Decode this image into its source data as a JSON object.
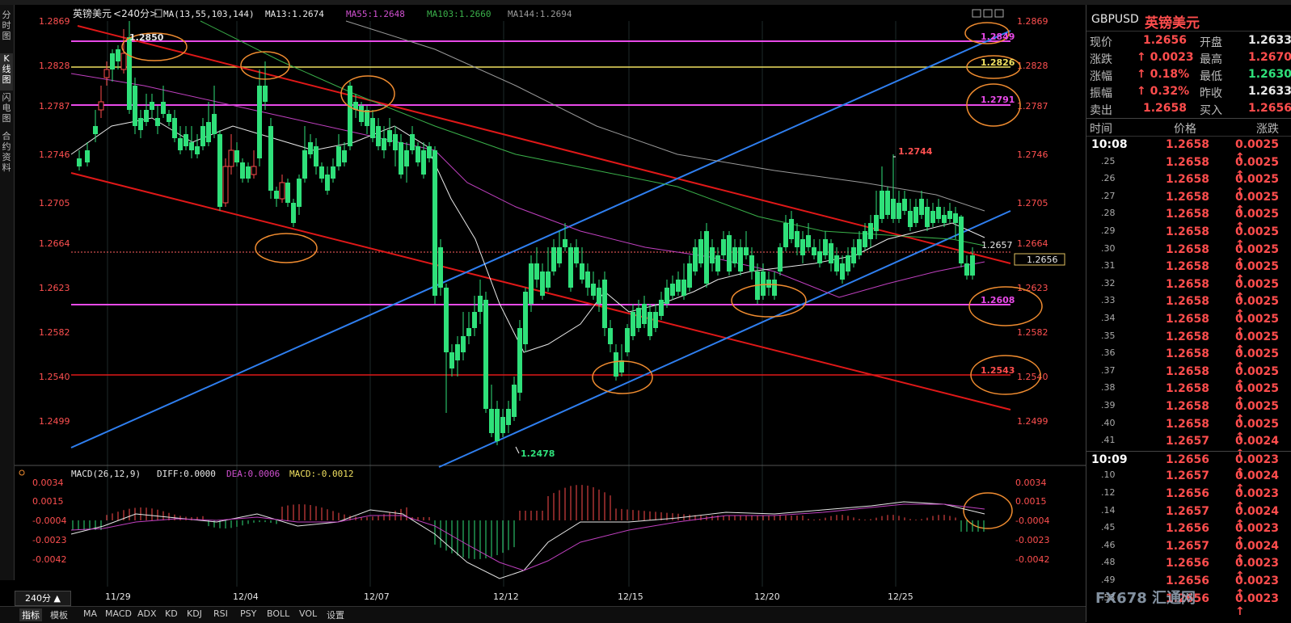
{
  "symbol_name": "英镑美元",
  "period": "240分",
  "ma_header": {
    "label": "MA(13,55,103,144)",
    "ma13": "MA13:1.2674",
    "ma55": "MA55:1.2648",
    "ma103": "MA103:1.2660",
    "ma144": "MA144:1.2694"
  },
  "left_tabs": [
    "分时图",
    "K线图",
    "闪电图",
    "合约资料"
  ],
  "price_axis": [
    "1.2869",
    "1.2828",
    "1.2787",
    "1.2746",
    "1.2705",
    "1.2664",
    "1.2623",
    "1.2582",
    "1.2540",
    "1.2499"
  ],
  "hlines": {
    "h1": "1.2849",
    "h2": "1.2826",
    "h3": "1.2791",
    "h4": "1.2608",
    "h5": "1.2543"
  },
  "annotations": {
    "high": "1.2850",
    "recent_high": "1.2744",
    "low": "1.2478",
    "last": "1.2657",
    "current_tag": "1.2656"
  },
  "macd_header": {
    "label": "MACD(26,12,9)",
    "diff": "DIFF:0.0000",
    "dea": "DEA:0.0006",
    "macd": "MACD:-0.0012"
  },
  "macd_axis": [
    "0.0034",
    "0.0015",
    "-0.0004",
    "-0.0023",
    "-0.0042"
  ],
  "dates": [
    "11/29",
    "12/04",
    "12/07",
    "12/12",
    "12/15",
    "12/20",
    "12/25"
  ],
  "bottom_tabs": [
    "指标",
    "模板",
    "MA",
    "MACD",
    "ADX",
    "KD",
    "KDJ",
    "RSI",
    "PSY",
    "BOLL",
    "VOL",
    "设置"
  ],
  "quote": {
    "code": "GBPUSD",
    "name": "英镑美元",
    "current_label": "现价",
    "current": "1.2656",
    "open_label": "开盘",
    "open": "1.2633",
    "change_label": "涨跌",
    "change": "0.0023",
    "high_label": "最高",
    "high": "1.2670",
    "pct_label": "涨幅",
    "pct": "0.18%",
    "low_label": "最低",
    "low": "1.2630",
    "amp_label": "振幅",
    "amp": "0.32%",
    "prev_label": "昨收",
    "prev": "1.2633",
    "sell_label": "卖出",
    "sell": "1.2658",
    "buy_label": "买入",
    "buy": "1.2656"
  },
  "ticks_header": {
    "time": "时间",
    "price": "价格",
    "change": "涨跌"
  },
  "ticks": [
    {
      "t": "10:08",
      "p": "1.2658",
      "c": "0.0025"
    },
    {
      "t": ".25",
      "p": "1.2658",
      "c": "0.0025"
    },
    {
      "t": ".26",
      "p": "1.2658",
      "c": "0.0025"
    },
    {
      "t": ".27",
      "p": "1.2658",
      "c": "0.0025"
    },
    {
      "t": ".28",
      "p": "1.2658",
      "c": "0.0025"
    },
    {
      "t": ".29",
      "p": "1.2658",
      "c": "0.0025"
    },
    {
      "t": ".30",
      "p": "1.2658",
      "c": "0.0025"
    },
    {
      "t": ".31",
      "p": "1.2658",
      "c": "0.0025"
    },
    {
      "t": ".32",
      "p": "1.2658",
      "c": "0.0025"
    },
    {
      "t": ".33",
      "p": "1.2658",
      "c": "0.0025"
    },
    {
      "t": ".34",
      "p": "1.2658",
      "c": "0.0025"
    },
    {
      "t": ".35",
      "p": "1.2658",
      "c": "0.0025"
    },
    {
      "t": ".36",
      "p": "1.2658",
      "c": "0.0025"
    },
    {
      "t": ".37",
      "p": "1.2658",
      "c": "0.0025"
    },
    {
      "t": ".38",
      "p": "1.2658",
      "c": "0.0025"
    },
    {
      "t": ".39",
      "p": "1.2658",
      "c": "0.0025"
    },
    {
      "t": ".40",
      "p": "1.2658",
      "c": "0.0025"
    },
    {
      "t": ".41",
      "p": "1.2657",
      "c": "0.0024"
    },
    {
      "t": "10:09",
      "p": "1.2656",
      "c": "0.0023"
    },
    {
      "t": ".10",
      "p": "1.2657",
      "c": "0.0024"
    },
    {
      "t": ".12",
      "p": "1.2656",
      "c": "0.0023"
    },
    {
      "t": ".14",
      "p": "1.2657",
      "c": "0.0024"
    },
    {
      "t": ".45",
      "p": "1.2656",
      "c": "0.0023"
    },
    {
      "t": ".46",
      "p": "1.2657",
      "c": "0.0024"
    },
    {
      "t": ".48",
      "p": "1.2656",
      "c": "0.0023"
    },
    {
      "t": ".49",
      "p": "1.2656",
      "c": "0.0023"
    },
    {
      "t": ".53",
      "p": "1.2656",
      "c": "0.0023"
    }
  ],
  "watermark": "FX678 汇通网",
  "colors": {
    "up": "#ff4d4d",
    "down": "#2fe07a",
    "channel_red": "#e01818",
    "channel_blue": "#2f7ff0",
    "ma13": "#e8e8e8",
    "ma55": "#c040c0",
    "ma103": "#3ab04a",
    "ma144": "#9a9a9a",
    "magenta_line": "#e84ae8",
    "yellow_line": "#f0e060",
    "ellipse": "#f08c30"
  }
}
